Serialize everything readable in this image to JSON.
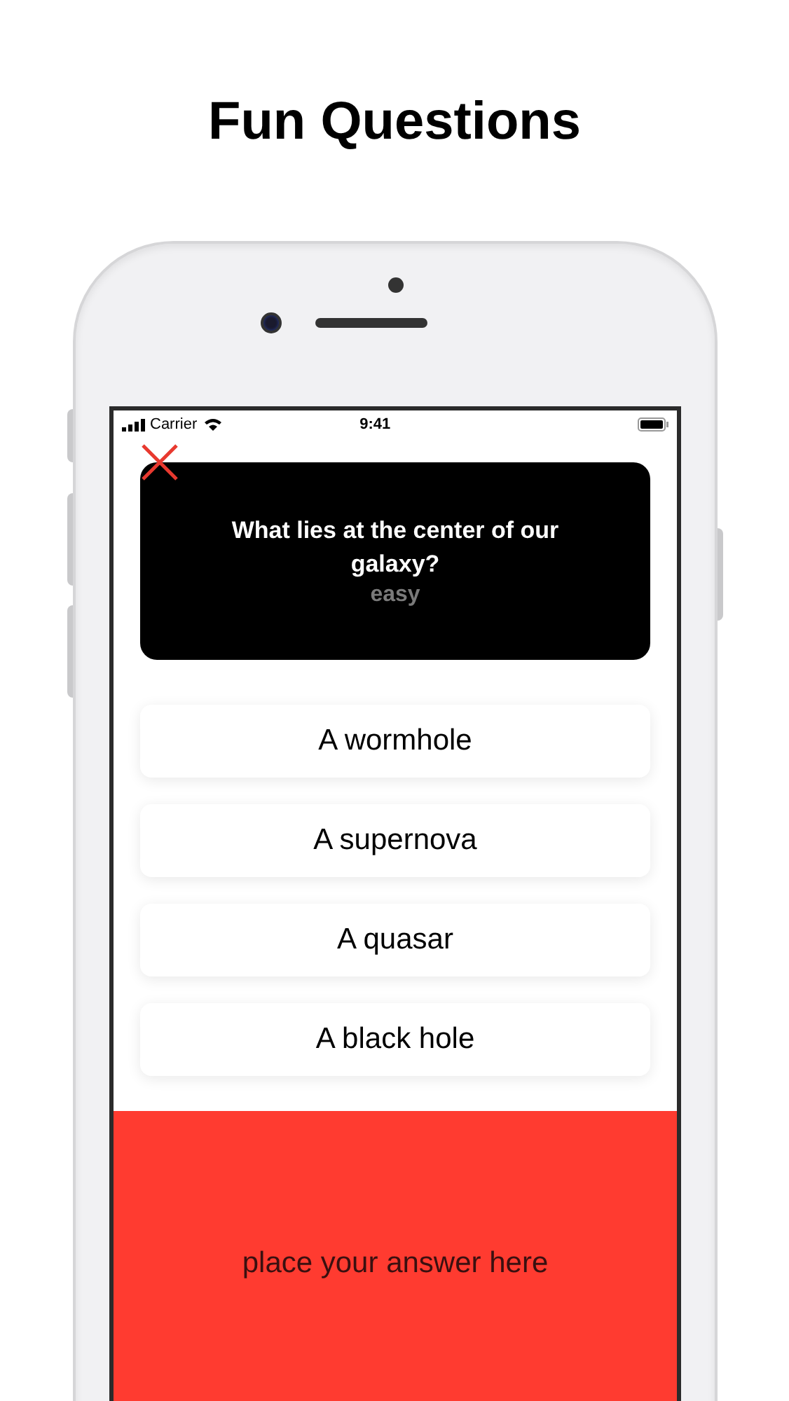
{
  "title": "Fun Questions",
  "status_bar": {
    "carrier": "Carrier",
    "time": "9:41"
  },
  "question": {
    "text": "What lies at the center of our galaxy?",
    "difficulty": "easy"
  },
  "answers": [
    {
      "label": "A wormhole"
    },
    {
      "label": "A supernova"
    },
    {
      "label": "A quasar"
    },
    {
      "label": "A black hole"
    }
  ],
  "drop_zone": {
    "label": "place your answer here"
  }
}
